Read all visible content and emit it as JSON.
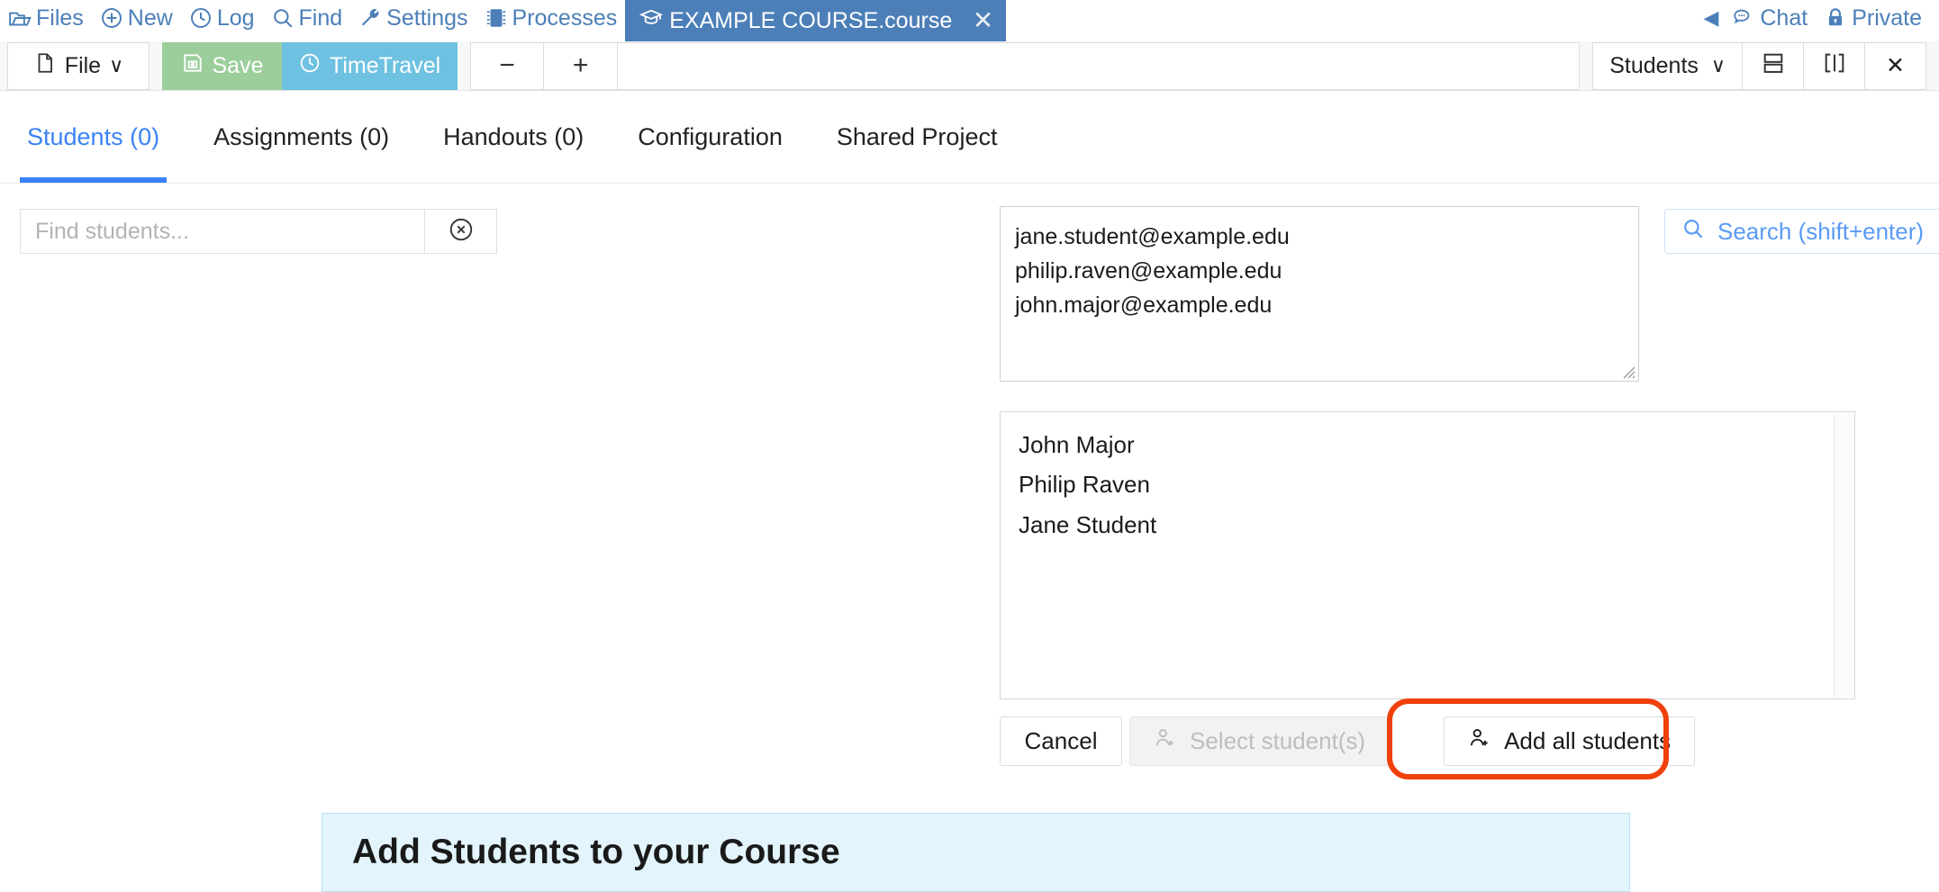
{
  "topnav": {
    "items": [
      {
        "label": "Files",
        "icon": "folder-open-icon"
      },
      {
        "label": "New",
        "icon": "plus-circle-icon"
      },
      {
        "label": "Log",
        "icon": "clock-icon"
      },
      {
        "label": "Find",
        "icon": "search-icon"
      },
      {
        "label": "Settings",
        "icon": "wrench-icon"
      },
      {
        "label": "Processes",
        "icon": "microchip-icon"
      }
    ],
    "course_tab": {
      "label": "EXAMPLE COURSE.course",
      "icon": "graduation-cap-icon",
      "close": "✕"
    },
    "right": [
      {
        "label": "Chat",
        "icon": "comments-icon"
      },
      {
        "label": "Private",
        "icon": "lock-icon"
      }
    ],
    "collapse_arrow": "◀"
  },
  "toolbar": {
    "file_label": "File",
    "file_caret": "∨",
    "save_label": "Save",
    "timetravel_label": "TimeTravel",
    "zoom_out": "−",
    "zoom_in": "+",
    "students_label": "Students",
    "students_caret": "∨",
    "split_horizontal_icon": "split-horizontal-icon",
    "split_vertical_icon": "split-vertical-icon",
    "close_label": "✕"
  },
  "tabs": [
    {
      "label": "Students (0)",
      "active": true
    },
    {
      "label": "Assignments (0)",
      "active": false
    },
    {
      "label": "Handouts (0)",
      "active": false
    },
    {
      "label": "Configuration",
      "active": false
    },
    {
      "label": "Shared Project",
      "active": false
    }
  ],
  "find": {
    "placeholder": "Find students...",
    "value": "",
    "clear_icon": "clear-circle-icon"
  },
  "add_students": {
    "emails_value": "jane.student@example.edu\nphilip.raven@example.edu\njohn.major@example.edu",
    "emails": [
      "jane.student@example.edu",
      "philip.raven@example.edu",
      "john.major@example.edu"
    ],
    "search_button_label": "Search (shift+enter)",
    "results": [
      "John Major",
      "Philip Raven",
      "Jane Student"
    ],
    "cancel_label": "Cancel",
    "select_students_label": "Select student(s)",
    "add_all_label": "Add all students"
  },
  "banner": {
    "title": "Add Students to your Course"
  },
  "colors": {
    "nav_blue": "#4c7fb8",
    "tab_active_blue": "#3b82f6",
    "save_green": "#9bce9b",
    "timetravel_blue": "#6ec1e0",
    "highlight_red": "#f0400b",
    "banner_bg": "#e3f4fd",
    "banner_border": "#b9e0f5",
    "link_blue": "#5a9bf6"
  }
}
